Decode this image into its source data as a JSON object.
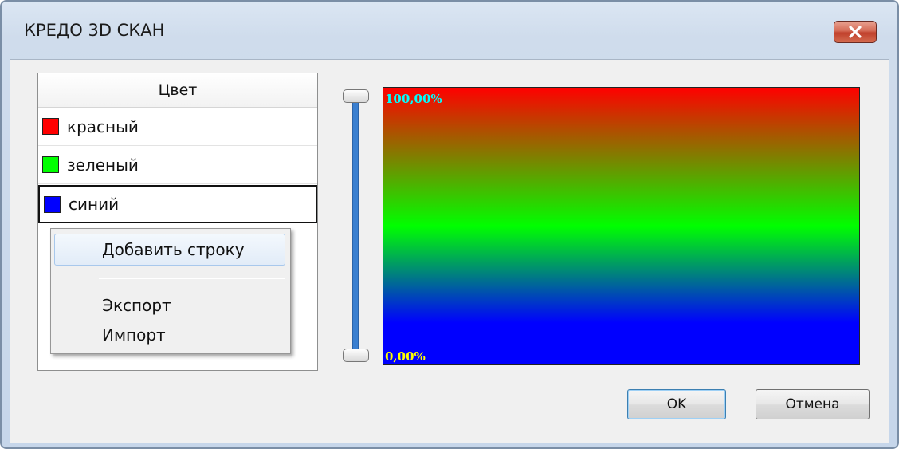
{
  "window": {
    "title": "КРЕДО 3D СКАН",
    "close_icon": "close-icon"
  },
  "color_list": {
    "header": "Цвет",
    "rows": [
      {
        "label": "красный",
        "color": "#ff0000"
      },
      {
        "label": "зеленый",
        "color": "#00ff00"
      },
      {
        "label": "синий",
        "color": "#0000ff"
      }
    ],
    "selected_index": 2
  },
  "context_menu": {
    "items": [
      "Добавить строку",
      "Экспорт",
      "Импорт"
    ],
    "highlighted_index": 0
  },
  "gradient": {
    "top_label": "100,00%",
    "bottom_label": "0,00%",
    "top_label_color": "#00ffff",
    "bottom_label_color": "#ffff00",
    "stops": [
      "#ff0000",
      "#00ff00",
      "#0000ff"
    ]
  },
  "buttons": {
    "ok": "OK",
    "cancel": "Отмена"
  }
}
